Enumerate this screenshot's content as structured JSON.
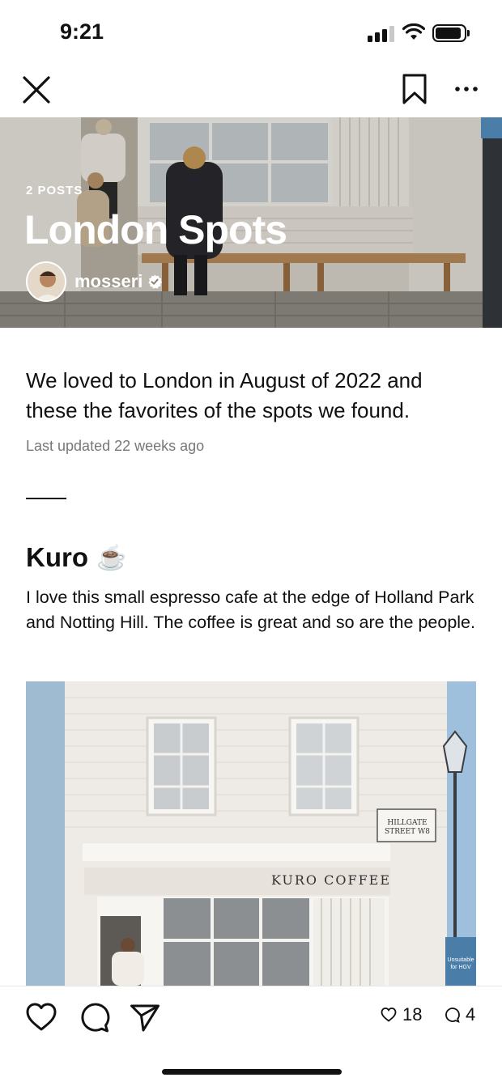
{
  "status_bar": {
    "time": "9:21"
  },
  "nav": {
    "close_icon": "close-icon",
    "bookmark_icon": "bookmark-icon",
    "more_icon": "more-icon"
  },
  "hero": {
    "kicker": "2 POSTS",
    "title": "London Spots",
    "username": "mosseri",
    "verified": true
  },
  "description": {
    "text": "We loved to London in August of 2022 and these the favorites of the spots we found.",
    "updated": "Last updated 22 weeks ago"
  },
  "post": {
    "title": "Kuro",
    "emoji": "☕",
    "body": "I love this small espresso cafe at the edge of Holland Park and Notting Hill. The coffee is great and so are the people.",
    "photo_sign": "KURO COFFEE",
    "street_sign": "HILLGATE STREET W8",
    "road_sign": "Unsuitable for HGV"
  },
  "bottom_bar": {
    "likes": "18",
    "comments": "4"
  },
  "colors": {
    "text": "#111111",
    "muted": "#777777",
    "background": "#ffffff"
  }
}
